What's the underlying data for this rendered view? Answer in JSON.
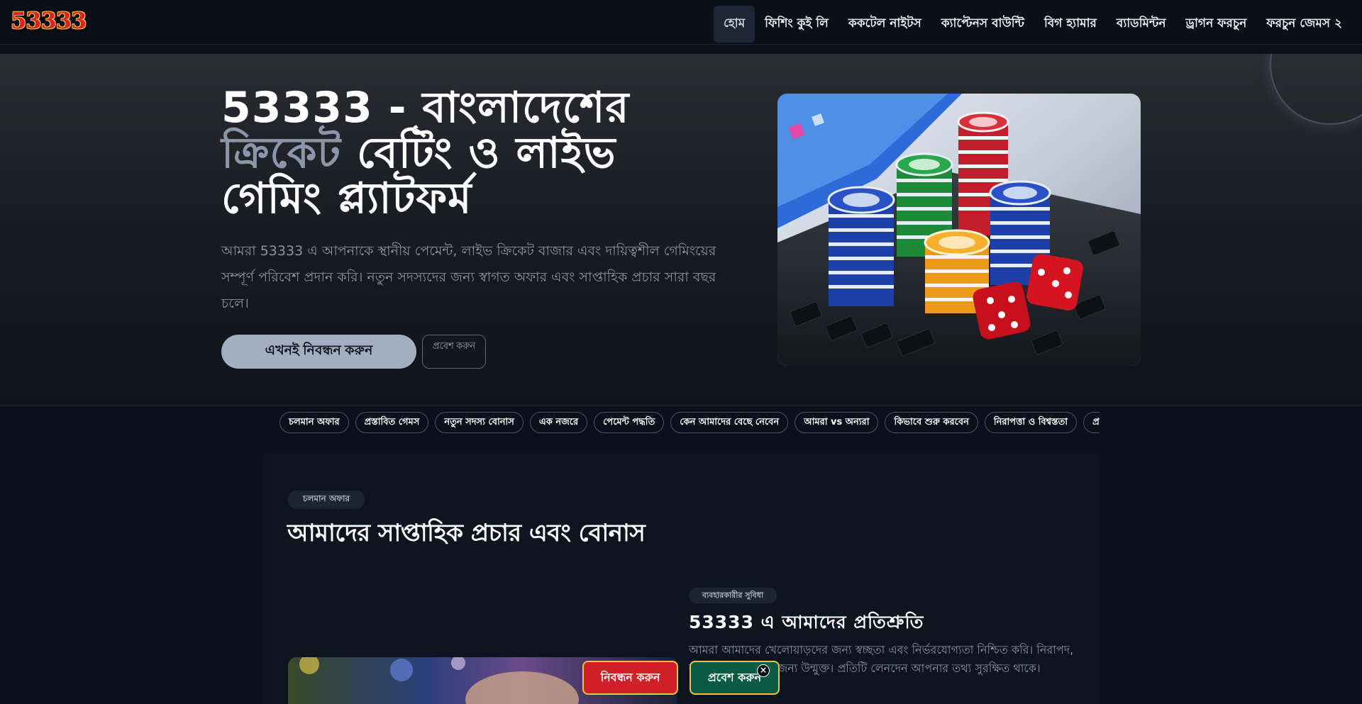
{
  "header": {
    "logo_text": "53333",
    "nav": [
      {
        "label": "হোম",
        "active": true
      },
      {
        "label": "ফিশিং কুই লি"
      },
      {
        "label": "ককটেল নাইটস"
      },
      {
        "label": "ক্যাপ্টেনস বাউন্টি"
      },
      {
        "label": "বিগ হ্যামার"
      },
      {
        "label": "ব্যাডমিন্টন"
      },
      {
        "label": "ড্রাগন ফরচুন"
      },
      {
        "label": "ফরচুন জেমস ২"
      }
    ]
  },
  "hero": {
    "title_part1": "53333 - বাংলাদেশের ",
    "title_highlight": "ক্রিকেট",
    "title_part2": " বেটিং ও লাইভ গেমিং প্ল্যাটফর্ম",
    "description": "আমরা 53333 এ আপনাকে স্থানীয় পেমেন্ট, লাইভ ক্রিকেট বাজার এবং দায়িত্বশীল গেমিংয়ের সম্পূর্ণ পরিবেশ প্রদান করি। নতুন সদস্যদের জন্য স্বাগত অফার এবং সাপ্তাহিক প্রচার সারা বছর চলে।",
    "primary_button": "এখনই নিবন্ধন করুন",
    "secondary_button": "প্রবেশ করুন",
    "image_icon": "casino-chips-dice-laptop-image"
  },
  "tabs": [
    "চলমান অফার",
    "প্রস্তাবিত গেমস",
    "নতুন সদস্য বোনাস",
    "এক নজরে",
    "পেমেন্ট পদ্ধতি",
    "কেন আমাদের বেছে নেবেন",
    "আমরা vs অন্যরা",
    "কিভাবে শুরু করবেন",
    "নিরাপত্তা ও বিশ্বস্ততা",
    "প্র"
  ],
  "content": {
    "badge": "চলমান অফার",
    "title": "আমাদের সাপ্তাহিক প্রচার এবং বোনাস",
    "promise_badge": "ব্যবহারকারীর সুবিধা",
    "promise_title": "53333 এ আমাদের প্রতিশ্রুতি",
    "promise_desc": "আমরা আমাদের খেলোয়াড়দের জন্য স্বচ্ছতা এবং নির্ভরযোগ্যতা নিশ্চিত করি। নিরাপদ, ন্যায্য এবং সকলের জন্য উন্মুক্ত। প্রতিটি লেনদেন আপনার তথ্য সুরক্ষিত থাকে।"
  },
  "sticky_bar": {
    "register": "নিবন্ধন করুন",
    "login": "প্রবেশ করুন",
    "close": "×"
  },
  "colors": {
    "background": "#0b111c",
    "accent_button": "#a3aebf",
    "register_red": "#d11f28",
    "login_green": "#0b5b43",
    "gold_border": "#f0c24a"
  }
}
